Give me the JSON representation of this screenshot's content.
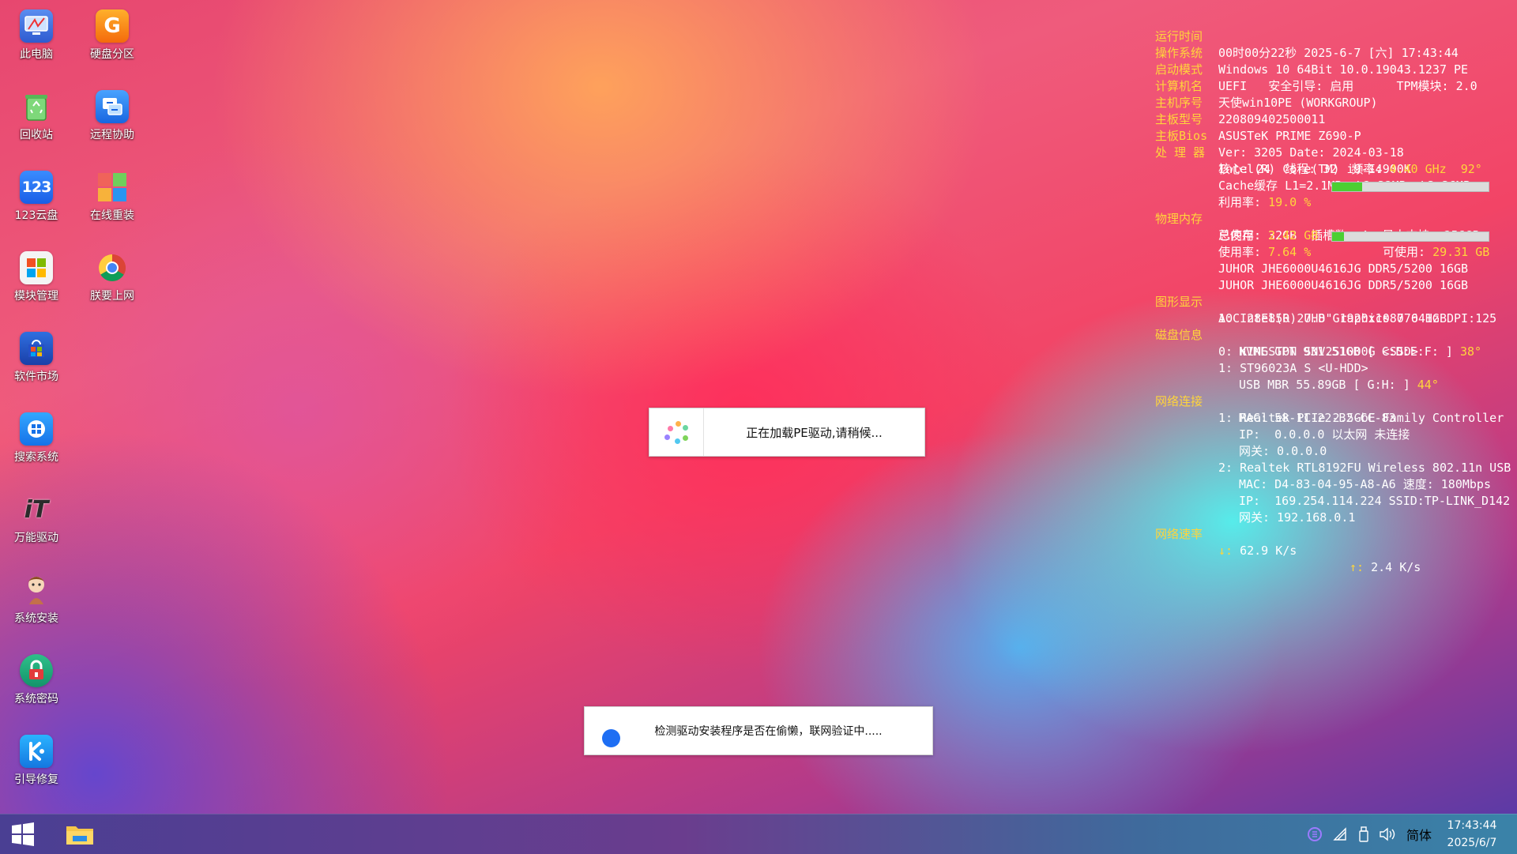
{
  "desktop_icons": [
    {
      "id": "this-pc",
      "label": "此电脑"
    },
    {
      "id": "disk-partition",
      "label": "硬盘分区"
    },
    {
      "id": "recycle-bin",
      "label": "回收站"
    },
    {
      "id": "remote-assist",
      "label": "远程协助"
    },
    {
      "id": "cloud-123",
      "label": "123云盘"
    },
    {
      "id": "online-reinstall",
      "label": "在线重装"
    },
    {
      "id": "module-manager",
      "label": "模块管理"
    },
    {
      "id": "browser",
      "label": "朕要上网"
    },
    {
      "id": "software-market",
      "label": "软件市场"
    },
    {
      "id": "search-system",
      "label": "搜索系统"
    },
    {
      "id": "universal-driver",
      "label": "万能驱动"
    },
    {
      "id": "system-install",
      "label": "系统安装"
    },
    {
      "id": "system-password",
      "label": "系统密码"
    },
    {
      "id": "boot-repair",
      "label": "引导修复"
    }
  ],
  "icon_glyphs": {
    "cloud_123": "123",
    "universal_driver": "iT"
  },
  "info": {
    "uptime_label": "运行时间",
    "uptime_value": "00时00分22秒 2025-6-7 [六] 17:43:44",
    "os_label": "操作系统",
    "os_value": "Windows 10 64Bit 10.0.19043.1237 PE",
    "boot_label": "启动模式",
    "boot_value": "UEFI   安全引导: 启用      TPM模块: 2.0",
    "hostname_label": "计算机名",
    "hostname_value": "天使win10PE (WORKGROUP)",
    "serial_label": "主机序号",
    "serial_value": "220809402500011",
    "board_label": "主板型号",
    "board_value": "ASUSTeK PRIME Z690-P",
    "bios_label": "主板Bios",
    "bios_value": "Ver: 3205 Date: 2024-03-18",
    "cpu_label": "处 理 器",
    "cpu_value": "Intel(R) Core(TM) i9-14900K",
    "cpu_detail_prefix": "核心: 24  线程: 32  频率: ",
    "cpu_freq": "4.40 GHz",
    "cpu_temp": "92°",
    "cpu_cache": "Cache缓存 L1=2.1MB  L2=32MB  L3=36MB",
    "cpu_usage_prefix": "利用率: ",
    "cpu_usage": "19.0 %",
    "cpu_usage_fraction": 0.19,
    "mem_label": "物理内存",
    "mem_total": "总内存: 32GB  插槽数: 4  最大支持: 256GB",
    "mem_used_prefix": "已使用: ",
    "mem_used": "2.42 GB",
    "mem_avail_prefix": "可使用: ",
    "mem_avail": "29.31 GB",
    "mem_usage_prefix": "使用率: ",
    "mem_usage": "7.64 %",
    "mem_usage_fraction": 0.0764,
    "mem_slot1": "JUHOR JHE6000U4616JG DDR5/5200 16GB",
    "mem_slot2": "JUHOR JHE6000U4616JG DDR5/5200 16GB",
    "gpu_label": "图形显示",
    "gpu_monitor": "AOC 28E850 27.8\" 1920x1080 64Hz DPI:125",
    "gpu_card": "1: Intel(R) UHD Graphics 770 1GB",
    "disk_label": "磁盘信息",
    "disk0_name": "0: KINGSTON SNV2S1000G <SSD>",
    "disk0_detail": "NVME GPT 931.51GB [ C:D:E:F: ] ",
    "disk0_temp": "38°",
    "disk1_name": "1: ST96023A S <U-HDD>",
    "disk1_detail": "USB MBR 55.89GB [ G:H: ] ",
    "disk1_temp": "44°",
    "net_label": "网络连接",
    "net1_name": "1: Realtek PCIe 2.5GbE Family Controller",
    "net1_mac": "MAC: 58-11-22-B2-CC-83",
    "net1_ip": "IP:  0.0.0.0 以太网 未连接",
    "net1_gw": "网关: 0.0.0.0",
    "net2_name": "2: Realtek RTL8192FU Wireless 802.11n USB",
    "net2_mac": "MAC: D4-83-04-95-A8-A6 速度: 180Mbps",
    "net2_ip": "IP:  169.254.114.224 SSID:TP-LINK_D142",
    "net2_gw": "网关: 192.168.0.1",
    "speed_label": "网络速率",
    "down_arrow": "↓:",
    "down_speed": "62.9 K/s",
    "up_arrow": "↑:",
    "up_speed": "2.4 K/s"
  },
  "dialogs": {
    "loading_msg": "正在加载PE驱动,请稍候...",
    "verify_msg": "检测驱动安装程序是否在偷懒，联网验证中....."
  },
  "taskbar": {
    "lang": "简体",
    "time": "17:43:44",
    "date": "2025/6/7"
  },
  "colors": {
    "label_yellow": "#ffd53b",
    "bar_green": "#4ccf33",
    "spinner_blue": "#1e6ef3"
  }
}
